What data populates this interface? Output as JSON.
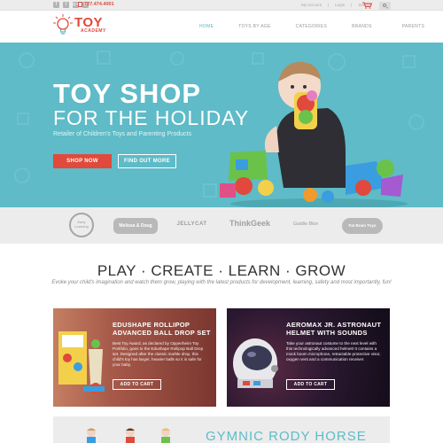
{
  "topbar": {
    "social": [
      "f",
      "t",
      "g+",
      "p"
    ],
    "phone": "727.474.4001",
    "links": [
      "My account",
      "|",
      "Login",
      "|",
      "Search"
    ]
  },
  "logo": {
    "line1": "TOY",
    "line2": "ACADEMY"
  },
  "nav": {
    "items": [
      "HOME",
      "TOYS BY AGE",
      "CATEGORIES",
      "BRANDS",
      "PARENTS"
    ]
  },
  "hero": {
    "title": "TOY SHOP",
    "subtitle": "FOR THE HOLIDAY",
    "description": "Retailer of Children's Toys and Parenting Products",
    "primary_button": "SHOP NOW",
    "secondary_button": "FIND OUT MORE",
    "bg_color": "#5ebbc7"
  },
  "brands": [
    "Early Learning",
    "Melissa & Doug",
    "JELLYCAT",
    "ThinkGeek",
    "Goldie Blox",
    "Fat Brain Toys"
  ],
  "intro": {
    "heading": "PLAY · CREATE · LEARN · GROW",
    "text": "Evoke your child's imagination and watch them grow, playing with the latest products for development, learning, safety and most importantly, fun!"
  },
  "products": [
    {
      "title": "EDUSHAPE ROLLIPOP ADVANCED BALL DROP SET",
      "description": "Best Toy Award, as declared by Oppenheim Toy Portfolio, goes to the Edushape Rollipop Ball Drop set. Designed after the classic marble drop, this child's toy has larger, heavier balls so it is safe for your baby.",
      "button": "ADD TO CART"
    },
    {
      "title": "AEROMAX JR. ASTRONAUT HELMET WITH SOUNDS",
      "description": "Take your astronaut costume to the next level with this technologically advanced helmet! It contains a mock boom microphone, retractable protective visor, oxygen vent and a communication receiver.",
      "button": "ADD TO CART"
    }
  ],
  "feature": {
    "title": "GYMNIC RODY HORSE"
  },
  "colors": {
    "accent": "#e0493b",
    "teal": "#5ebbc7"
  }
}
